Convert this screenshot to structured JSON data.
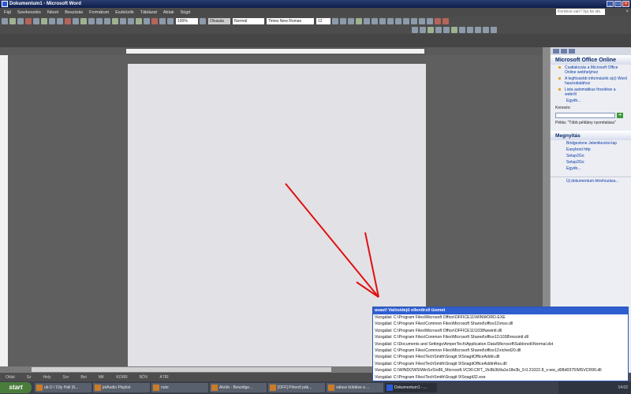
{
  "window": {
    "title": "Dokumentum1 - Microsoft Word"
  },
  "menu": {
    "items": [
      "Fájl",
      "Szerkesztés",
      "Nézet",
      "Beszúrás",
      "Formátum",
      "Eszközök",
      "Táblázat",
      "Ablak",
      "Súgó"
    ],
    "help_placeholder": "Kérdése van? Írja be ide."
  },
  "toolbar": {
    "zoom": "100%",
    "read_label": "Olvasás",
    "style": "Normál",
    "font": "Times New Roman",
    "size": "12"
  },
  "task_pane": {
    "title": "Microsoft Office Online",
    "links": [
      "Csatlakozás a Microsoft Office Online webhelyhez",
      "A legfrissebb információk a(z) Word használatához",
      "Lista automatikus frissítése a webről"
    ],
    "more": "Egyéb...",
    "search_label": "Keresés:",
    "example": "Példa: \"Több példány nyomtatása\"",
    "open_section": "Megnyitás",
    "recent": [
      "Bridgestone Jelentkezési-lap",
      "Easyboot http",
      "Setup2Go",
      "Setup2Go"
    ],
    "open_more": "Egyéb...",
    "new_doc": "Új dokumentum létrehozása..."
  },
  "status_bar": {
    "fields": [
      "Oldal",
      "Sz",
      "Hely",
      "Sor",
      "Bet",
      "MK",
      "KORR",
      "BŐV",
      "ÁTÍR"
    ]
  },
  "taskbar": {
    "start": "start",
    "tasks": [
      "ub D / City Hall (6...",
      "jetAudio Playlist",
      "nute",
      "Akrób - Beszélge...",
      "[OFF] Pihenő pák...",
      "válasz küldése a ...",
      "Dokumentum1 - ..."
    ],
    "clock": "14:02"
  },
  "popup": {
    "title": "avast! Valósidejű ellenőrző üzenet",
    "lines": [
      "Vizsgálat: C:\\Program Files\\Microsoft Office\\OFFICE11\\WINWORD.EXE",
      "Vizsgálat: C:\\Program Files\\Common Files\\Microsoft Shared\\office11\\mso.dll",
      "Vizsgálat: C:\\Program Files\\Microsoft Office\\OFFICE11\\1038\\wwintl.dll",
      "Vizsgálat: C:\\Program Files\\Common Files\\Microsoft Shared\\office11\\1038\\msointl.dll",
      "Vizsgálat: C:\\Documents and Settings\\AmperTech\\Application Data\\Microsoft\\Sablonok\\Normal.dot",
      "Vizsgálat: C:\\Program Files\\Common Files\\Microsoft Shared\\office11\\riched20.dll",
      "Vizsgálat: C:\\Program Files\\TechSmith\\Snagit 9\\SnagitOfficeAddin.dll",
      "Vizsgálat: C:\\Program Files\\TechSmith\\Snagit 9\\SnagitOfficeAddinRes.dll",
      "Vizsgálat: C:\\WINDOWS\\WinSxS\\x86_Microsoft.VC90.CRT_1fc8b3b9a1e18e3b_9.0.21022.8_x-ww_d08d0375\\MSVCR90.dll",
      "Vizsgálat: C:\\Program Files\\TechSmith\\Snagit 9\\Snagit32.exe"
    ]
  }
}
